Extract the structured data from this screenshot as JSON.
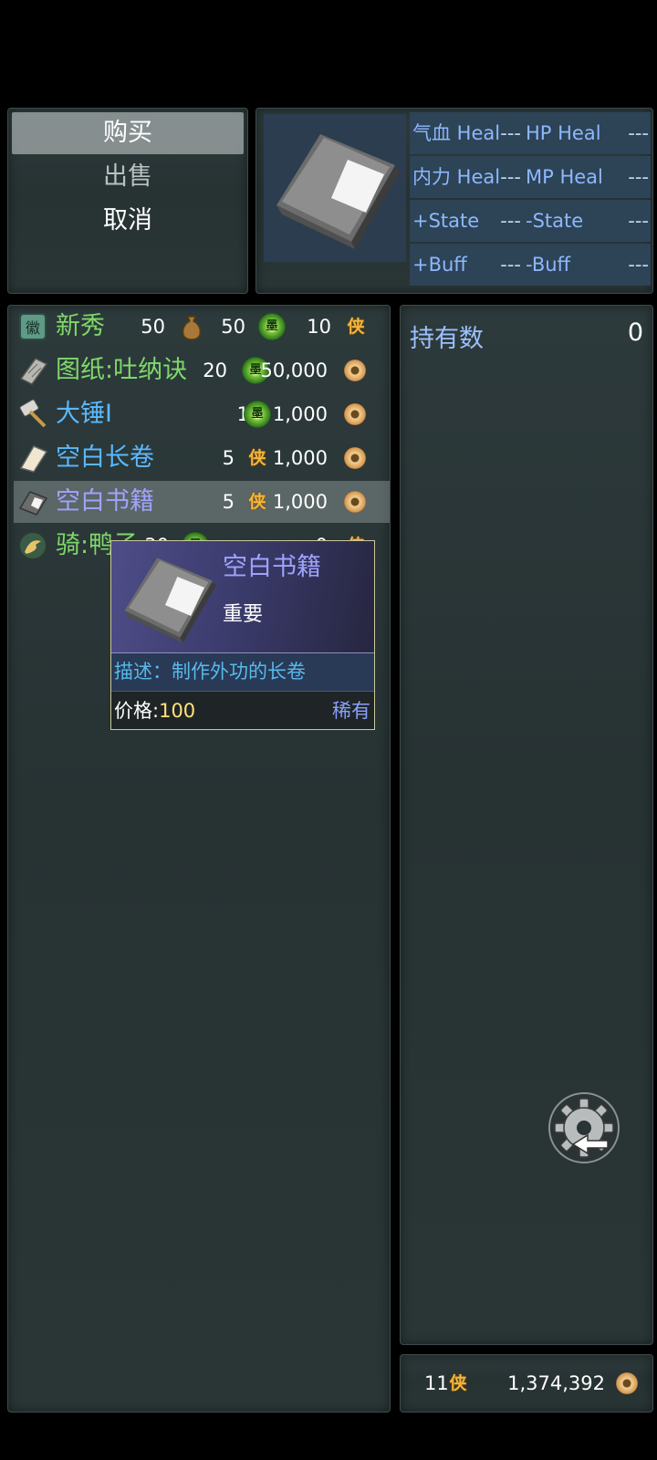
{
  "command_menu": {
    "items": [
      {
        "label": "购买",
        "state": "selected"
      },
      {
        "label": "出售",
        "state": "disabled"
      },
      {
        "label": "取消",
        "state": "normal"
      }
    ]
  },
  "item_info": {
    "icon": "blank-book-icon",
    "stats": [
      {
        "label": "气血 Heal",
        "value": "---"
      },
      {
        "label": "HP Heal",
        "value": "---"
      },
      {
        "label": "内力 Heal",
        "value": "---"
      },
      {
        "label": "MP Heal",
        "value": "---"
      },
      {
        "label": "+State",
        "value": "---"
      },
      {
        "label": "-State",
        "value": "---"
      },
      {
        "label": "+Buff",
        "value": "---"
      },
      {
        "label": "-Buff",
        "value": "---"
      }
    ]
  },
  "shop_items": [
    {
      "name": "新秀",
      "name_color": "#7fd86a",
      "icon": "jade-badge-icon",
      "price1": "50",
      "price1_icon": "money-bag-icon",
      "price2": "50",
      "price2_icon": "jade-medal-icon",
      "price3": "10",
      "price3_icon": "xia-token-icon"
    },
    {
      "name": "图纸:吐纳诀",
      "name_color": "#7fd86a",
      "icon": "scroll-plan-icon",
      "price1": "20",
      "price1_icon": "jade-medal-icon",
      "price2": "50,000",
      "price2_icon": "copper-coin-icon"
    },
    {
      "name": "大锤I",
      "name_color": "#5ab8ff",
      "icon": "hammer-icon",
      "price1": "1",
      "price1_icon": "jade-medal-icon",
      "price2": "1,000",
      "price2_icon": "copper-coin-icon"
    },
    {
      "name": "空白长卷",
      "name_color": "#5ab8ff",
      "icon": "blank-scroll-icon",
      "price1": "5",
      "price1_icon": "xia-token-icon",
      "price2": "1,000",
      "price2_icon": "copper-coin-icon"
    },
    {
      "name": "空白书籍",
      "name_color": "#9fa3ff",
      "icon": "blank-book-icon",
      "selected": true,
      "price1": "5",
      "price1_icon": "xia-token-icon",
      "price2": "1,000",
      "price2_icon": "copper-coin-icon"
    },
    {
      "name": "骑:鸭子",
      "name_color": "#7fd86a",
      "icon": "duck-mount-icon",
      "price1": "30",
      "price1_icon": "jade-medal-icon",
      "price2": "0",
      "price2_icon": "xia-token-icon"
    }
  ],
  "tooltip": {
    "name": "空白书籍",
    "tag": "重要",
    "description": "描述：制作外功的长卷",
    "price_label": "价格:",
    "price_value": "100",
    "rarity": "稀有"
  },
  "status": {
    "owned_label": "持有数",
    "owned_value": "0"
  },
  "currency": {
    "xia": "11",
    "coins": "1,374,392"
  },
  "glyphs": {
    "xia": "侠",
    "jade": "墨"
  },
  "colors": {
    "panel_bg": "#2a3637",
    "highlight_blue": "#9fa3ff",
    "stat_blue": "#8db8ff",
    "coin_gold": "#d69a52",
    "xia_orange": "#f5b53a"
  }
}
